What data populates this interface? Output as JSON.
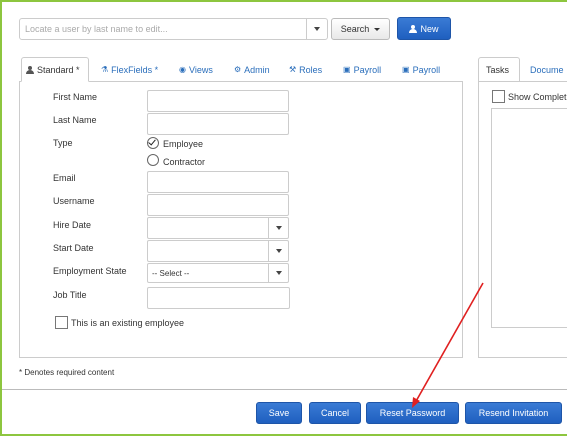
{
  "search": {
    "placeholder": "Locate a user by last name to edit...",
    "button_label": "Search",
    "new_label": "New"
  },
  "tabs": [
    {
      "label": "Standard *",
      "icon": "user-icon"
    },
    {
      "label": "FlexFields *",
      "icon": "flask-icon"
    },
    {
      "label": "Views",
      "icon": "eye-icon"
    },
    {
      "label": "Admin",
      "icon": "gear-icon"
    },
    {
      "label": "Roles",
      "icon": "wrench-icon"
    },
    {
      "label": "Payroll",
      "icon": "money-icon"
    },
    {
      "label": "Payroll",
      "icon": "money-icon"
    }
  ],
  "form": {
    "first_name_label": "First Name",
    "last_name_label": "Last Name",
    "type_label": "Type",
    "type_options": [
      "Employee",
      "Contractor"
    ],
    "type_selected": "Employee",
    "email_label": "Email",
    "username_label": "Username",
    "hire_date_label": "Hire Date",
    "start_date_label": "Start Date",
    "employment_state_label": "Employment State",
    "employment_state_value": "-- Select --",
    "job_title_label": "Job Title",
    "existing_employee_label": "This is an existing employee"
  },
  "right_panel": {
    "tabs": [
      "Tasks",
      "Docume"
    ],
    "show_completed_label": "Show Complet"
  },
  "footnote": "* Denotes required content",
  "actions": {
    "save": "Save",
    "cancel": "Cancel",
    "reset_password": "Reset Password",
    "resend_invitation": "Resend Invitation"
  },
  "colors": {
    "frame_border": "#8dc63f",
    "primary": "#2463c4",
    "link": "#2a6ebb",
    "annotation_arrow": "#e02020"
  }
}
